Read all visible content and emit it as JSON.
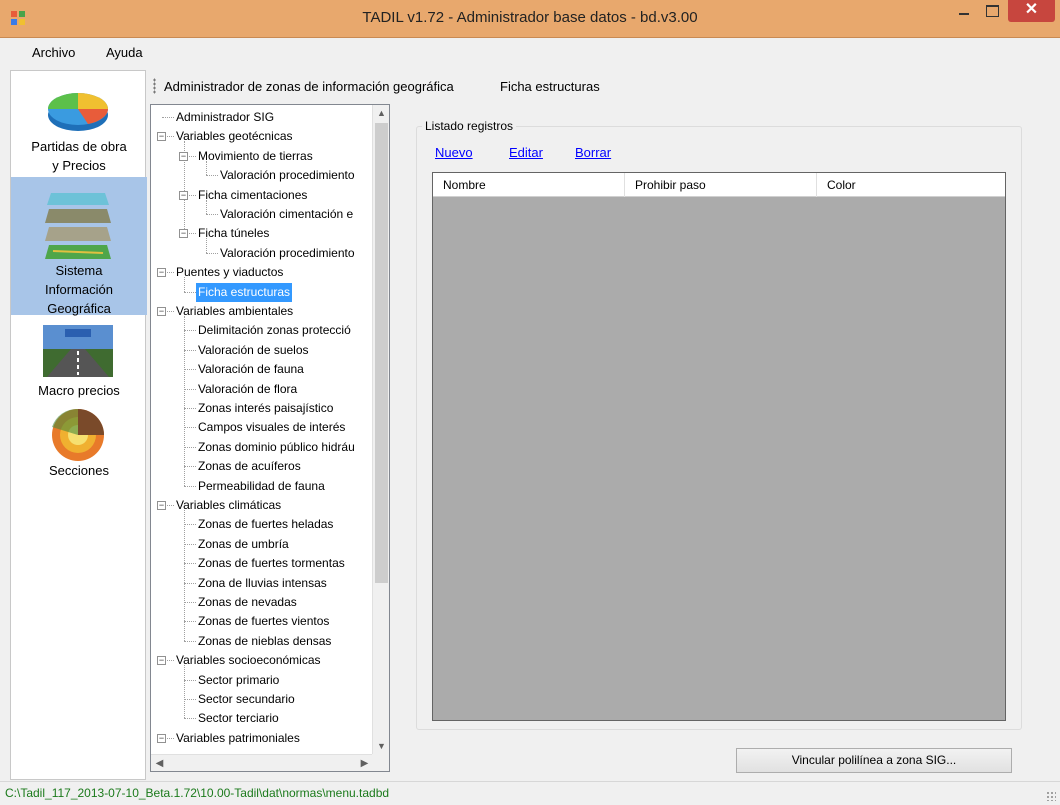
{
  "window": {
    "title": "TADIL v1.72 - Administrador base datos - bd.v3.00",
    "close_glyph": "✕"
  },
  "menu": {
    "items": [
      "Archivo",
      "Ayuda"
    ]
  },
  "left_nav": {
    "items": [
      {
        "label": "Partidas de obra\ny Precios",
        "icon": "pie-chart-icon",
        "selected": false
      },
      {
        "label": "Sistema\nInformación\nGeográfica",
        "icon": "map-layers-icon",
        "selected": true
      },
      {
        "label": "Macro precios",
        "icon": "road-icon",
        "selected": false
      },
      {
        "label": "Secciones",
        "icon": "earth-section-icon",
        "selected": false
      }
    ]
  },
  "breadcrumb": {
    "parts": [
      "Administrador de zonas de información geográfica",
      "Ficha estructuras"
    ]
  },
  "tree": {
    "items": [
      {
        "label": "Administrador SIG",
        "level": 0,
        "expander": ""
      },
      {
        "label": "Variables geotécnicas",
        "level": 0,
        "expander": "−"
      },
      {
        "label": "Movimiento de tierras",
        "level": 1,
        "expander": "−"
      },
      {
        "label": "Valoración procedimiento",
        "level": 2,
        "expander": ""
      },
      {
        "label": "Ficha cimentaciones",
        "level": 1,
        "expander": "−"
      },
      {
        "label": "Valoración cimentación e",
        "level": 2,
        "expander": ""
      },
      {
        "label": "Ficha túneles",
        "level": 1,
        "expander": "−"
      },
      {
        "label": "Valoración procedimiento",
        "level": 2,
        "expander": ""
      },
      {
        "label": "Puentes y viaductos",
        "level": 0,
        "expander": "−"
      },
      {
        "label": "Ficha estructuras",
        "level": 1,
        "expander": "",
        "selected": true
      },
      {
        "label": "Variables ambientales",
        "level": 0,
        "expander": "−"
      },
      {
        "label": "Delimitación zonas protecció",
        "level": 1,
        "expander": ""
      },
      {
        "label": "Valoración de suelos",
        "level": 1,
        "expander": ""
      },
      {
        "label": "Valoración de fauna",
        "level": 1,
        "expander": ""
      },
      {
        "label": "Valoración de flora",
        "level": 1,
        "expander": ""
      },
      {
        "label": "Zonas interés paisajístico",
        "level": 1,
        "expander": ""
      },
      {
        "label": "Campos visuales de interés",
        "level": 1,
        "expander": ""
      },
      {
        "label": "Zonas dominio público hidráu",
        "level": 1,
        "expander": ""
      },
      {
        "label": "Zonas de acuíferos",
        "level": 1,
        "expander": ""
      },
      {
        "label": "Permeabilidad de fauna",
        "level": 1,
        "expander": ""
      },
      {
        "label": "Variables climáticas",
        "level": 0,
        "expander": "−"
      },
      {
        "label": "Zonas de fuertes heladas",
        "level": 1,
        "expander": ""
      },
      {
        "label": "Zonas de umbría",
        "level": 1,
        "expander": ""
      },
      {
        "label": "Zonas de fuertes tormentas",
        "level": 1,
        "expander": ""
      },
      {
        "label": "Zona de lluvias intensas",
        "level": 1,
        "expander": ""
      },
      {
        "label": "Zonas de nevadas",
        "level": 1,
        "expander": ""
      },
      {
        "label": "Zonas de fuertes vientos",
        "level": 1,
        "expander": ""
      },
      {
        "label": "Zonas de nieblas densas",
        "level": 1,
        "expander": ""
      },
      {
        "label": "Variables socioeconómicas",
        "level": 0,
        "expander": "−"
      },
      {
        "label": "Sector primario",
        "level": 1,
        "expander": ""
      },
      {
        "label": "Sector secundario",
        "level": 1,
        "expander": ""
      },
      {
        "label": "Sector terciario",
        "level": 1,
        "expander": ""
      },
      {
        "label": "Variables patrimoniales",
        "level": 0,
        "expander": "−"
      }
    ]
  },
  "panel": {
    "group_title": "Listado registros",
    "links": {
      "new": "Nuevo",
      "edit": "Editar",
      "delete": "Borrar"
    },
    "grid_columns": [
      "Nombre",
      "Prohibir paso",
      "Color"
    ],
    "link_button": "Vincular polilínea a zona SIG..."
  },
  "status": {
    "path": "C:\\Tadil_117_2013-07-10_Beta.1.72\\10.00-Tadil\\dat\\normas\\menu.tadbd"
  },
  "colors": {
    "titlebar": "#e8a86d",
    "selection": "#3399ff",
    "nav_selected": "#a8c5e8",
    "link": "#0000ff",
    "status_text": "#1b7a1b",
    "grid_background": "#ababab"
  }
}
